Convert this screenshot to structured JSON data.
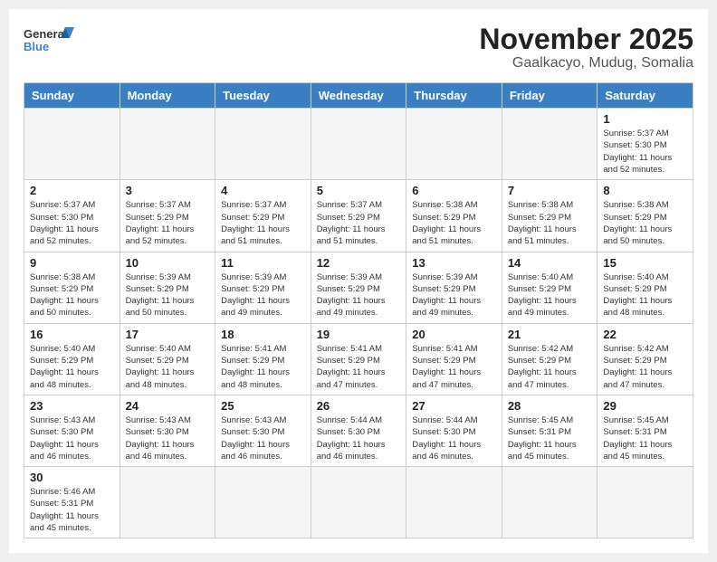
{
  "header": {
    "logo_general": "General",
    "logo_blue": "Blue",
    "month_title": "November 2025",
    "location": "Gaalkacyo, Mudug, Somalia"
  },
  "weekdays": [
    "Sunday",
    "Monday",
    "Tuesday",
    "Wednesday",
    "Thursday",
    "Friday",
    "Saturday"
  ],
  "weeks": [
    [
      {
        "day": null,
        "info": null
      },
      {
        "day": null,
        "info": null
      },
      {
        "day": null,
        "info": null
      },
      {
        "day": null,
        "info": null
      },
      {
        "day": null,
        "info": null
      },
      {
        "day": null,
        "info": null
      },
      {
        "day": "1",
        "info": "Sunrise: 5:37 AM\nSunset: 5:30 PM\nDaylight: 11 hours\nand 52 minutes."
      }
    ],
    [
      {
        "day": "2",
        "info": "Sunrise: 5:37 AM\nSunset: 5:30 PM\nDaylight: 11 hours\nand 52 minutes."
      },
      {
        "day": "3",
        "info": "Sunrise: 5:37 AM\nSunset: 5:29 PM\nDaylight: 11 hours\nand 52 minutes."
      },
      {
        "day": "4",
        "info": "Sunrise: 5:37 AM\nSunset: 5:29 PM\nDaylight: 11 hours\nand 51 minutes."
      },
      {
        "day": "5",
        "info": "Sunrise: 5:37 AM\nSunset: 5:29 PM\nDaylight: 11 hours\nand 51 minutes."
      },
      {
        "day": "6",
        "info": "Sunrise: 5:38 AM\nSunset: 5:29 PM\nDaylight: 11 hours\nand 51 minutes."
      },
      {
        "day": "7",
        "info": "Sunrise: 5:38 AM\nSunset: 5:29 PM\nDaylight: 11 hours\nand 51 minutes."
      },
      {
        "day": "8",
        "info": "Sunrise: 5:38 AM\nSunset: 5:29 PM\nDaylight: 11 hours\nand 50 minutes."
      }
    ],
    [
      {
        "day": "9",
        "info": "Sunrise: 5:38 AM\nSunset: 5:29 PM\nDaylight: 11 hours\nand 50 minutes."
      },
      {
        "day": "10",
        "info": "Sunrise: 5:39 AM\nSunset: 5:29 PM\nDaylight: 11 hours\nand 50 minutes."
      },
      {
        "day": "11",
        "info": "Sunrise: 5:39 AM\nSunset: 5:29 PM\nDaylight: 11 hours\nand 49 minutes."
      },
      {
        "day": "12",
        "info": "Sunrise: 5:39 AM\nSunset: 5:29 PM\nDaylight: 11 hours\nand 49 minutes."
      },
      {
        "day": "13",
        "info": "Sunrise: 5:39 AM\nSunset: 5:29 PM\nDaylight: 11 hours\nand 49 minutes."
      },
      {
        "day": "14",
        "info": "Sunrise: 5:40 AM\nSunset: 5:29 PM\nDaylight: 11 hours\nand 49 minutes."
      },
      {
        "day": "15",
        "info": "Sunrise: 5:40 AM\nSunset: 5:29 PM\nDaylight: 11 hours\nand 48 minutes."
      }
    ],
    [
      {
        "day": "16",
        "info": "Sunrise: 5:40 AM\nSunset: 5:29 PM\nDaylight: 11 hours\nand 48 minutes."
      },
      {
        "day": "17",
        "info": "Sunrise: 5:40 AM\nSunset: 5:29 PM\nDaylight: 11 hours\nand 48 minutes."
      },
      {
        "day": "18",
        "info": "Sunrise: 5:41 AM\nSunset: 5:29 PM\nDaylight: 11 hours\nand 48 minutes."
      },
      {
        "day": "19",
        "info": "Sunrise: 5:41 AM\nSunset: 5:29 PM\nDaylight: 11 hours\nand 47 minutes."
      },
      {
        "day": "20",
        "info": "Sunrise: 5:41 AM\nSunset: 5:29 PM\nDaylight: 11 hours\nand 47 minutes."
      },
      {
        "day": "21",
        "info": "Sunrise: 5:42 AM\nSunset: 5:29 PM\nDaylight: 11 hours\nand 47 minutes."
      },
      {
        "day": "22",
        "info": "Sunrise: 5:42 AM\nSunset: 5:29 PM\nDaylight: 11 hours\nand 47 minutes."
      }
    ],
    [
      {
        "day": "23",
        "info": "Sunrise: 5:43 AM\nSunset: 5:30 PM\nDaylight: 11 hours\nand 46 minutes."
      },
      {
        "day": "24",
        "info": "Sunrise: 5:43 AM\nSunset: 5:30 PM\nDaylight: 11 hours\nand 46 minutes."
      },
      {
        "day": "25",
        "info": "Sunrise: 5:43 AM\nSunset: 5:30 PM\nDaylight: 11 hours\nand 46 minutes."
      },
      {
        "day": "26",
        "info": "Sunrise: 5:44 AM\nSunset: 5:30 PM\nDaylight: 11 hours\nand 46 minutes."
      },
      {
        "day": "27",
        "info": "Sunrise: 5:44 AM\nSunset: 5:30 PM\nDaylight: 11 hours\nand 46 minutes."
      },
      {
        "day": "28",
        "info": "Sunrise: 5:45 AM\nSunset: 5:31 PM\nDaylight: 11 hours\nand 45 minutes."
      },
      {
        "day": "29",
        "info": "Sunrise: 5:45 AM\nSunset: 5:31 PM\nDaylight: 11 hours\nand 45 minutes."
      }
    ],
    [
      {
        "day": "30",
        "info": "Sunrise: 5:46 AM\nSunset: 5:31 PM\nDaylight: 11 hours\nand 45 minutes."
      },
      {
        "day": null,
        "info": null
      },
      {
        "day": null,
        "info": null
      },
      {
        "day": null,
        "info": null
      },
      {
        "day": null,
        "info": null
      },
      {
        "day": null,
        "info": null
      },
      {
        "day": null,
        "info": null
      }
    ]
  ]
}
